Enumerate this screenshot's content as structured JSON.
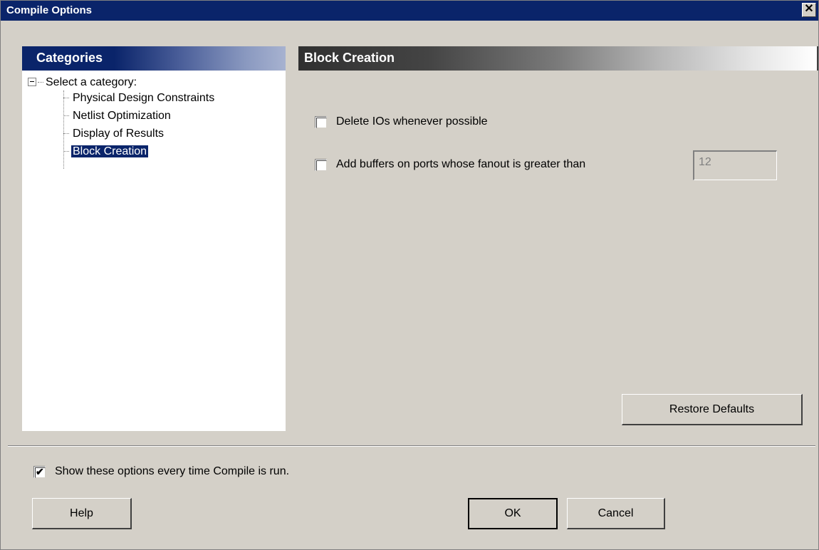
{
  "window": {
    "title": "Compile Options",
    "close_glyph": "✕"
  },
  "categories": {
    "header": "Categories",
    "root_label": "Select a category:",
    "items": [
      {
        "label": "Physical Design Constraints",
        "selected": false
      },
      {
        "label": "Netlist Optimization",
        "selected": false
      },
      {
        "label": "Display of Results",
        "selected": false
      },
      {
        "label": "Block Creation",
        "selected": true
      }
    ]
  },
  "section": {
    "header": "Block Creation",
    "options": {
      "delete_ios": {
        "label": "Delete IOs whenever possible",
        "checked": false
      },
      "add_buffers": {
        "label": "Add buffers on ports whose fanout is greater than",
        "checked": false,
        "value": "12",
        "enabled": false
      }
    },
    "restore_defaults_label": "Restore Defaults"
  },
  "footer": {
    "show_options": {
      "label": "Show these options every time Compile is run.",
      "checked": true
    },
    "help_label": "Help",
    "ok_label": "OK",
    "cancel_label": "Cancel"
  },
  "colors": {
    "title_bar": "#0a246a",
    "selection": "#0a246a",
    "dialog_bg": "#d4d0c8"
  }
}
